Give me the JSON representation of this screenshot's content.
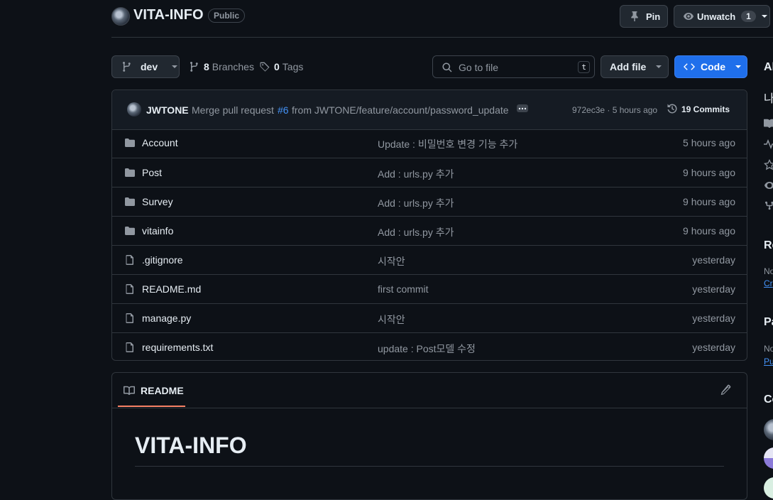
{
  "repo": {
    "name": "VITA-INFO",
    "visibility": "Public"
  },
  "header_actions": {
    "pin_label": "Pin",
    "unwatch_label": "Unwatch",
    "watch_count": "1"
  },
  "toolbar": {
    "branch": "dev",
    "branches_count": "8",
    "branches_label": "Branches",
    "tags_count": "0",
    "tags_label": "Tags",
    "search_placeholder": "Go to file",
    "search_shortcut": "t",
    "add_file_label": "Add file",
    "code_label": "Code"
  },
  "latest_commit": {
    "author": "JWTONE",
    "message_prefix": "Merge pull request",
    "pr_number": "#6",
    "message_suffix": "from JWTONE/feature/account/password_update",
    "sha_time": "972ec3e · 5 hours ago",
    "commits_count": "19 Commits"
  },
  "files": [
    {
      "type": "folder",
      "name": "Account",
      "message": "Update : 비밀번호 변경 기능 추가",
      "age": "5 hours ago"
    },
    {
      "type": "folder",
      "name": "Post",
      "message": "Add : urls.py 추가",
      "age": "9 hours ago"
    },
    {
      "type": "folder",
      "name": "Survey",
      "message": "Add : urls.py 추가",
      "age": "9 hours ago"
    },
    {
      "type": "folder",
      "name": "vitainfo",
      "message": "Add : urls.py 추가",
      "age": "9 hours ago"
    },
    {
      "type": "file",
      "name": ".gitignore",
      "message": "시작안",
      "age": "yesterday"
    },
    {
      "type": "file",
      "name": "README.md",
      "message": "first commit",
      "age": "yesterday"
    },
    {
      "type": "file",
      "name": "manage.py",
      "message": "시작안",
      "age": "yesterday"
    },
    {
      "type": "file",
      "name": "requirements.txt",
      "message": "update : Post모델 수정",
      "age": "yesterday"
    }
  ],
  "readme": {
    "tab_label": "README",
    "heading": "VITA-INFO"
  },
  "sidebar": {
    "about_fragment": "Al",
    "description_fragment": "나",
    "releases_fragment": "Re",
    "releases_note_fragment": "No",
    "releases_link_fragment": "Cr",
    "packages_fragment": "Pa",
    "packages_note_fragment": "No",
    "packages_link_fragment": "Pu",
    "contributors_fragment": "Co"
  },
  "colors": {
    "background": "#0d1117",
    "code_button": "#1f6feb",
    "link": "#4493f8",
    "tab_underline": "#f78166"
  }
}
